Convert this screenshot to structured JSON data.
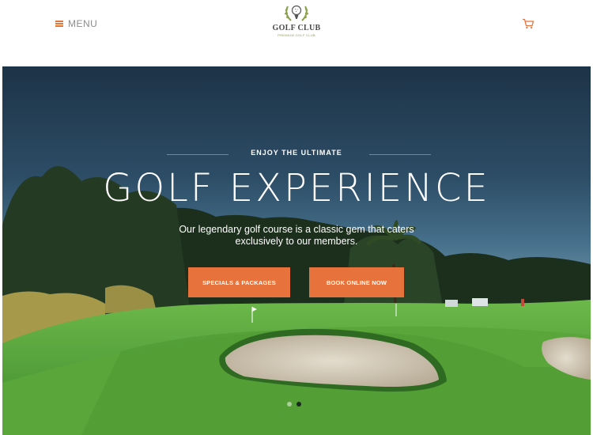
{
  "header": {
    "menu_label": "MENU",
    "logo_title": "GOLF CLUB",
    "logo_subtitle": "PREMIUM GOLF CLUB",
    "cart_icon": "cart-icon",
    "menu_icon": "hamburger-icon"
  },
  "hero": {
    "eyebrow": "ENJOY THE ULTIMATE",
    "headline": "GOLF EXPERIENCE",
    "tagline": "Our legendary golf course is a classic gem that caters exclusively to our members.",
    "buttons": [
      {
        "label": "SPECIALS & PACKAGES"
      },
      {
        "label": "BOOK ONLINE NOW"
      }
    ],
    "slides": {
      "count": 2,
      "active": 2
    }
  },
  "colors": {
    "accent": "#e8723b",
    "menu_text": "#8c8c8c",
    "logo_green": "#8aa04a",
    "sky_top": "#1d3347",
    "grass": "#5faa3a"
  }
}
